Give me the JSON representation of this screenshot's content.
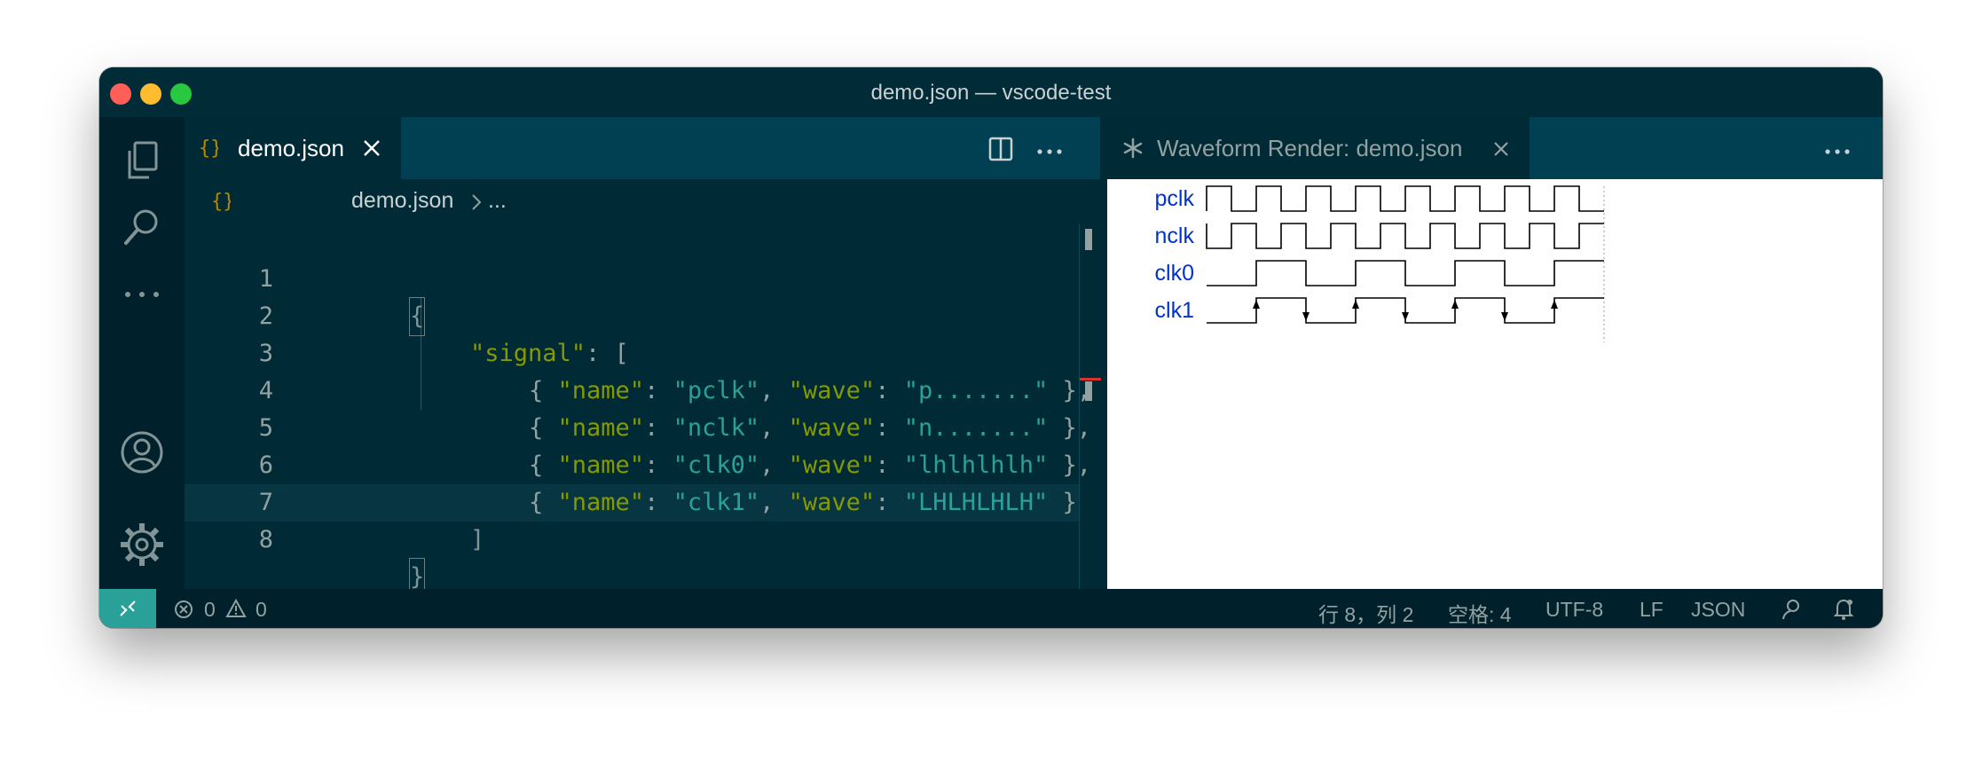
{
  "window": {
    "title": "demo.json — vscode-test"
  },
  "editor": {
    "tab_label": "demo.json",
    "breadcrumb_file": "demo.json",
    "breadcrumb_rest": "...",
    "lines": [
      {
        "n": "1"
      },
      {
        "n": "2"
      },
      {
        "n": "3"
      },
      {
        "n": "4"
      },
      {
        "n": "5"
      },
      {
        "n": "6"
      },
      {
        "n": "7"
      },
      {
        "n": "8"
      }
    ],
    "code": {
      "l1": "{",
      "signal": "\"signal\"",
      "colon_bracket": ": [",
      "open": "{ ",
      "name_key": "\"name\"",
      "wave_key": "\"wave\"",
      "sep": ": ",
      "comma": ", ",
      "close_comma": " },",
      "close": " }",
      "rows": [
        {
          "name": "\"pclk\"",
          "wave": "\"p.......\""
        },
        {
          "name": "\"nclk\"",
          "wave": "\"n.......\""
        },
        {
          "name": "\"clk0\"",
          "wave": "\"lhlhlhlh\""
        },
        {
          "name": "\"clk1\"",
          "wave": "\"LHLHLHLH\""
        }
      ],
      "l7": "]",
      "l8": "}"
    }
  },
  "preview": {
    "tab_label": "Waveform Render: demo.json",
    "signals": [
      {
        "name": "pclk",
        "wave": "p......."
      },
      {
        "name": "nclk",
        "wave": "n......."
      },
      {
        "name": "clk0",
        "wave": "lhlhlhlh"
      },
      {
        "name": "clk1",
        "wave": "LHLHLHLH"
      }
    ]
  },
  "statusbar": {
    "errors": "0",
    "warnings": "0",
    "position": "行 8，列 2",
    "spaces": "空格: 4",
    "encoding": "UTF-8",
    "eol": "LF",
    "language": "JSON"
  },
  "colors": {
    "signal_label": "#0033cc",
    "wave_stroke": "#000000",
    "accent": "#2aa198"
  },
  "icons": [
    "explorer-icon",
    "search-icon",
    "more-icon",
    "account-icon",
    "settings-icon",
    "json-icon",
    "split-editor-icon",
    "close-icon",
    "preview-icon",
    "remote-icon",
    "error-icon",
    "warning-icon",
    "feedback-icon",
    "bell-icon"
  ]
}
